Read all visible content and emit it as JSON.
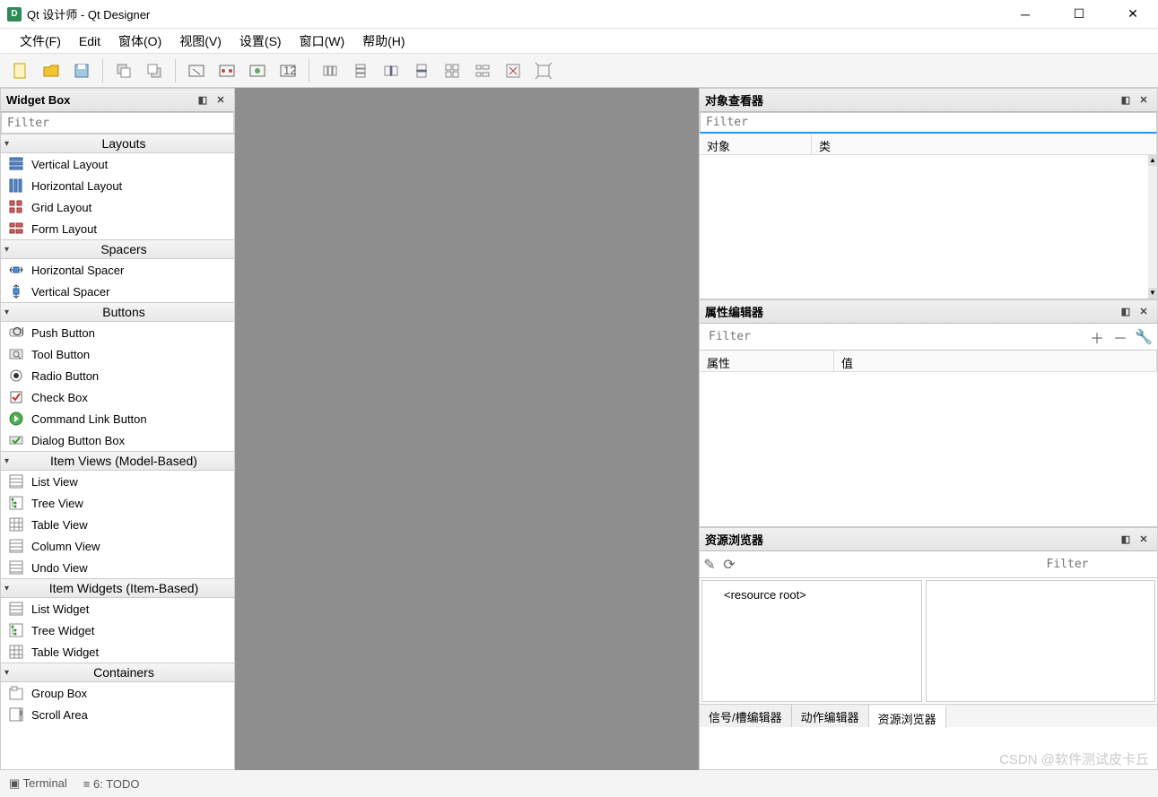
{
  "titlebar": {
    "title": "Qt 设计师 - Qt Designer",
    "app_icon_letter": "D"
  },
  "menubar": {
    "items": [
      {
        "label": "文件(F)"
      },
      {
        "label": "Edit"
      },
      {
        "label": "窗体(O)"
      },
      {
        "label": "视图(V)"
      },
      {
        "label": "设置(S)"
      },
      {
        "label": "窗口(W)"
      },
      {
        "label": "帮助(H)"
      }
    ]
  },
  "widgetbox": {
    "title": "Widget Box",
    "filter_placeholder": "Filter",
    "categories": [
      {
        "name": "Layouts",
        "items": [
          {
            "label": "Vertical Layout",
            "icon": "vlayout"
          },
          {
            "label": "Horizontal Layout",
            "icon": "hlayout"
          },
          {
            "label": "Grid Layout",
            "icon": "grid"
          },
          {
            "label": "Form Layout",
            "icon": "form"
          }
        ]
      },
      {
        "name": "Spacers",
        "items": [
          {
            "label": "Horizontal Spacer",
            "icon": "hspacer"
          },
          {
            "label": "Vertical Spacer",
            "icon": "vspacer"
          }
        ]
      },
      {
        "name": "Buttons",
        "items": [
          {
            "label": "Push Button",
            "icon": "pushbtn"
          },
          {
            "label": "Tool Button",
            "icon": "toolbtn"
          },
          {
            "label": "Radio Button",
            "icon": "radio"
          },
          {
            "label": "Check Box",
            "icon": "checkbox"
          },
          {
            "label": "Command Link Button",
            "icon": "cmdlink"
          },
          {
            "label": "Dialog Button Box",
            "icon": "dlgbox"
          }
        ]
      },
      {
        "name": "Item Views (Model-Based)",
        "items": [
          {
            "label": "List View",
            "icon": "view"
          },
          {
            "label": "Tree View",
            "icon": "tree"
          },
          {
            "label": "Table View",
            "icon": "table"
          },
          {
            "label": "Column View",
            "icon": "view"
          },
          {
            "label": "Undo View",
            "icon": "view"
          }
        ]
      },
      {
        "name": "Item Widgets (Item-Based)",
        "items": [
          {
            "label": "List Widget",
            "icon": "view"
          },
          {
            "label": "Tree Widget",
            "icon": "tree"
          },
          {
            "label": "Table Widget",
            "icon": "table"
          }
        ]
      },
      {
        "name": "Containers",
        "items": [
          {
            "label": "Group Box",
            "icon": "group"
          },
          {
            "label": "Scroll Area",
            "icon": "scroll"
          }
        ]
      }
    ]
  },
  "object_inspector": {
    "title": "对象查看器",
    "filter_placeholder": "Filter",
    "col_object": "对象",
    "col_class": "类"
  },
  "property_editor": {
    "title": "属性编辑器",
    "filter_placeholder": "Filter",
    "col_property": "属性",
    "col_value": "值"
  },
  "resource_browser": {
    "title": "资源浏览器",
    "filter_placeholder": "Filter",
    "root_label": "<resource root>",
    "tabs": [
      {
        "label": "信号/槽编辑器",
        "active": false
      },
      {
        "label": "动作编辑器",
        "active": false
      },
      {
        "label": "资源浏览器",
        "active": true
      }
    ]
  },
  "bottombar": {
    "terminal": "Terminal",
    "todo": "6: TODO"
  },
  "watermark": "CSDN @软件测试皮卡丘"
}
